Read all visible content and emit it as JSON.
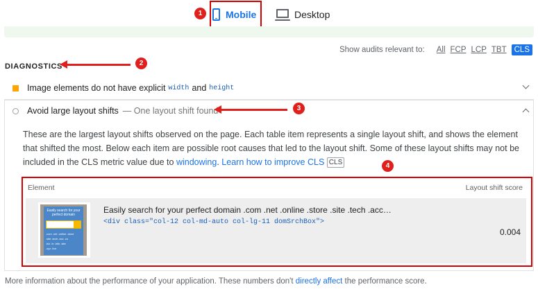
{
  "tabs": {
    "mobile": "Mobile",
    "desktop": "Desktop",
    "mobile_icon": "phone-icon",
    "desktop_icon": "monitor-icon"
  },
  "filter": {
    "label": "Show audits relevant to:",
    "options": [
      "All",
      "FCP",
      "LCP",
      "TBT"
    ],
    "active": "CLS"
  },
  "diagnostics_title": "DIAGNOSTICS",
  "audits": [
    {
      "prefix": "Image elements do not have explicit ",
      "code1": "width",
      "mid": " and ",
      "code2": "height",
      "status_color": "#ffa400",
      "expanded": false
    },
    {
      "title": "Avoid large layout shifts",
      "subtitle": "— One layout shift found",
      "expanded": true,
      "description_prefix": "These are the largest layout shifts observed on the page. Each table item represents a single layout shift, and shows the element that shifted the most. Below each item are possible root causes that led to the layout shift. Some of these layout shifts may not be included in the CLS metric value due to ",
      "link_windowing": "windowing",
      "link_learn": "Learn how to improve CLS",
      "chip": "CLS",
      "table": {
        "col_element": "Element",
        "col_score": "Layout shift score",
        "rows": [
          {
            "node_label": "Easily search for your perfect domain .com .net .online .store .site .tech .acc…",
            "snippet": "<div class=\"col-12 col-md-auto col-lg-11 domSrchBox\">",
            "score": "0.004",
            "thumb_heading": "Easily search for your perfect domain",
            "thumb_lines": [
              ".com .net .online .store",
              ".site .tech .acc .co",
              ".biz .in .info .site",
              ".xyz .live"
            ]
          }
        ]
      }
    }
  ],
  "footer": {
    "prefix": "More information about the performance of your application. These numbers don't ",
    "link": "directly affect",
    "suffix": " the performance score."
  },
  "annotations": [
    "1",
    "2",
    "3",
    "4"
  ],
  "colors": {
    "accent": "#1a73e8",
    "annotation_red": "#e0201c",
    "pass_band": "#eef8ef"
  }
}
